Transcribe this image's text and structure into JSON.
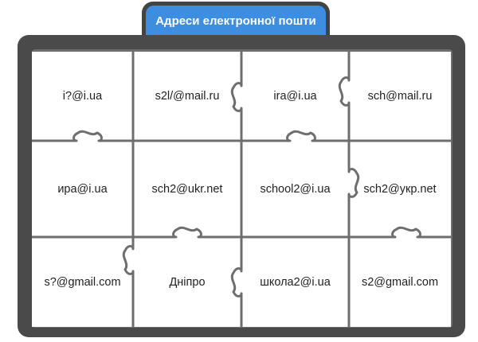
{
  "title": "Адреси електронної пошти",
  "colors": {
    "tab": "#3d8ee0",
    "frame": "#4a4a4a",
    "seam": "#6e6e6e",
    "tile": "#ffffff"
  },
  "grid": {
    "columns": 4,
    "rows": 3
  },
  "tiles": [
    {
      "id": "r1c1",
      "text": "i?@i.ua"
    },
    {
      "id": "r1c2",
      "text": "s2l/@mail.ru"
    },
    {
      "id": "r1c3",
      "text": "ira@i.ua"
    },
    {
      "id": "r1c4",
      "text": "sch@mail.ru"
    },
    {
      "id": "r2c1",
      "text": "ира@i.ua"
    },
    {
      "id": "r2c2",
      "text": "sch2@ukr.net"
    },
    {
      "id": "r2c3",
      "text": "school2@i.ua"
    },
    {
      "id": "r2c4",
      "text": "sch2@укр.net"
    },
    {
      "id": "r3c1",
      "text": "s?@gmail.com"
    },
    {
      "id": "r3c2",
      "text": "Дніпро"
    },
    {
      "id": "r3c3",
      "text": "школа2@i.ua"
    },
    {
      "id": "r3c4",
      "text": "s2@gmail.com"
    }
  ]
}
